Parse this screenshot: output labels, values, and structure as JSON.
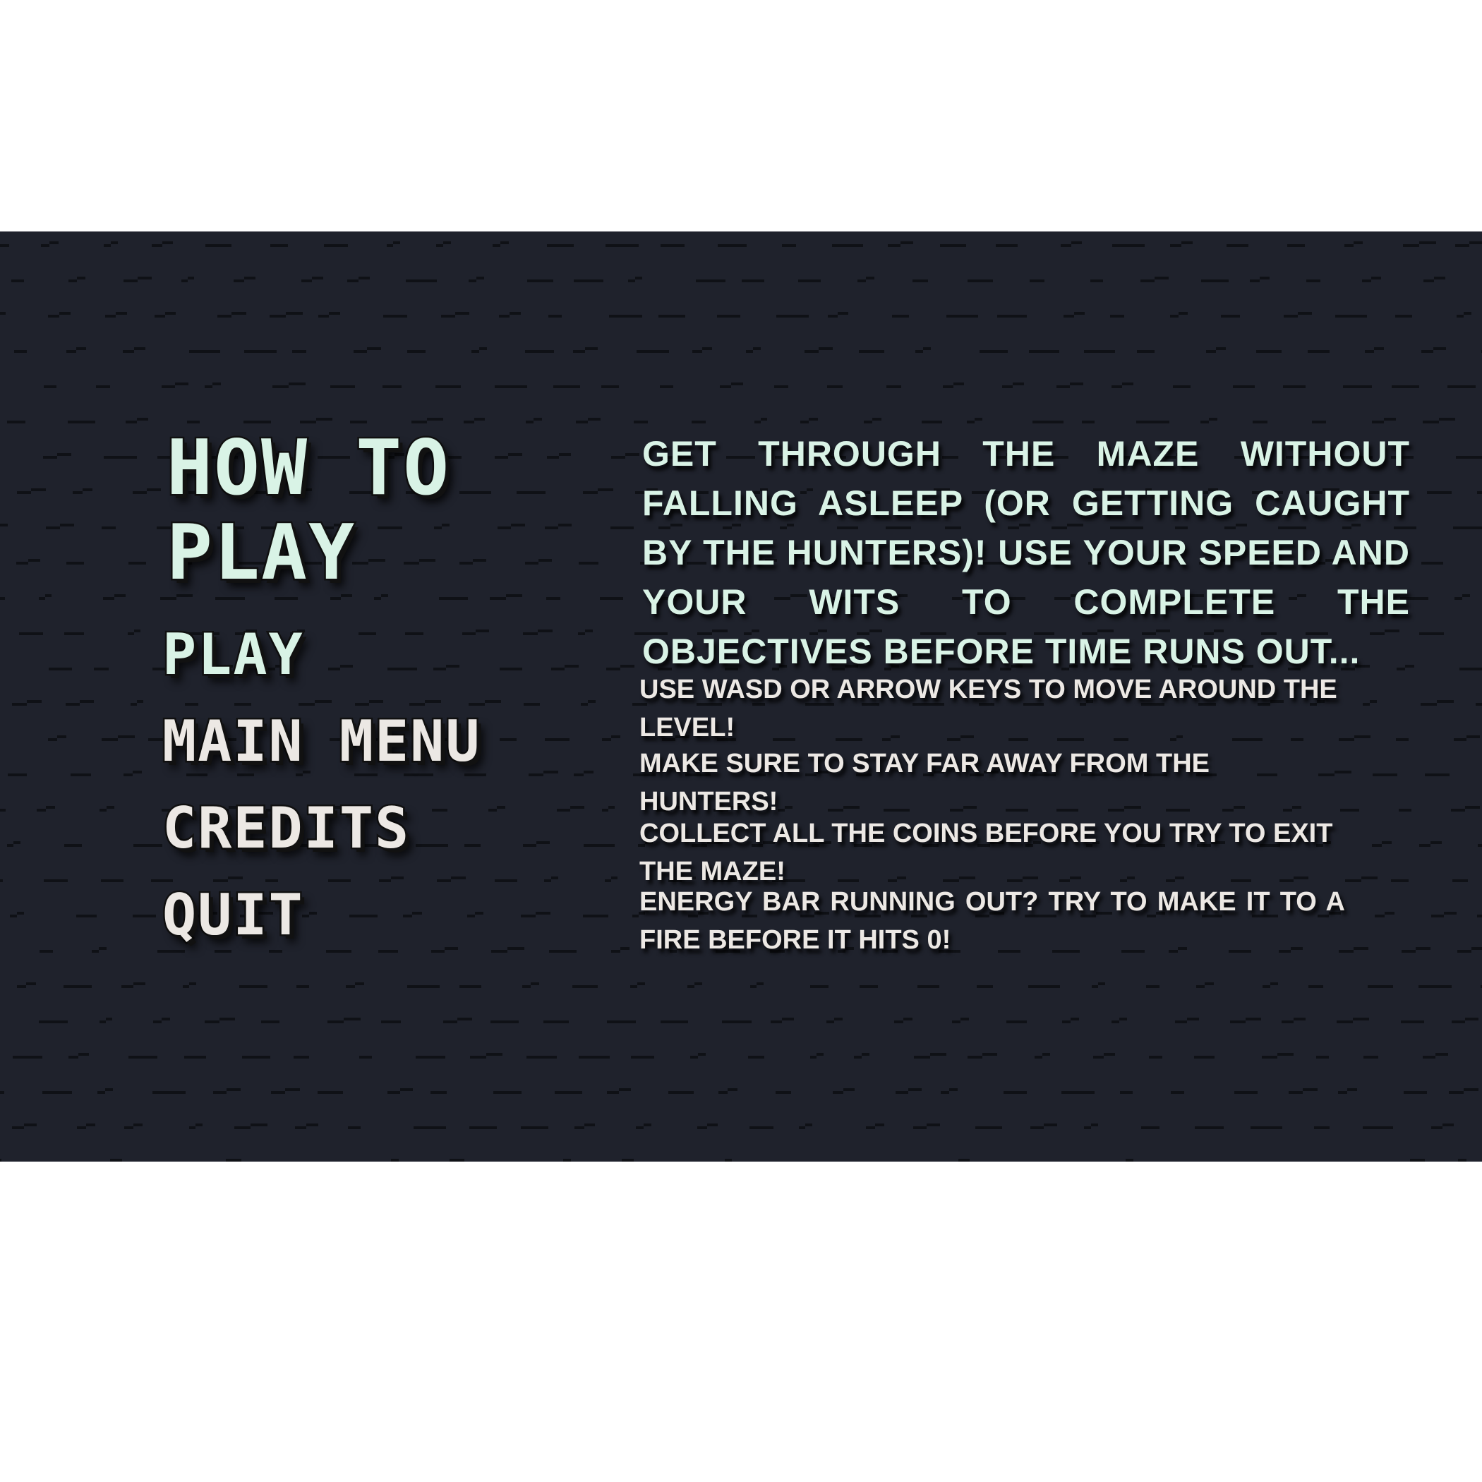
{
  "screen": {
    "title": "HOW TO PLAY"
  },
  "menu": {
    "items": [
      {
        "label": "PLAY"
      },
      {
        "label": "MAIN MENU"
      },
      {
        "label": "CREDITS"
      },
      {
        "label": "QUIT"
      }
    ]
  },
  "instructions": {
    "intro": "GET THROUGH THE MAZE WITHOUT FALLING ASLEEP (OR GETTING CAUGHT BY THE HUNTERS)! USE YOUR SPEED AND YOUR WITS TO COMPLETE THE OBJECTIVES BEFORE TIME RUNS OUT...",
    "tips": [
      "USE WASD OR ARROW KEYS TO MOVE AROUND THE LEVEL!",
      "MAKE SURE TO STAY FAR AWAY FROM THE HUNTERS!",
      "COLLECT ALL THE COINS BEFORE YOU TRY TO EXIT THE MAZE!",
      "ENERGY BAR RUNNING OUT? TRY TO MAKE IT TO A FIRE BEFORE IT HITS 0!"
    ]
  },
  "colors": {
    "background": "#1f222c",
    "mint_text": "#d9f3e6",
    "cream_text": "#ece8e4",
    "outline": "#111111"
  }
}
